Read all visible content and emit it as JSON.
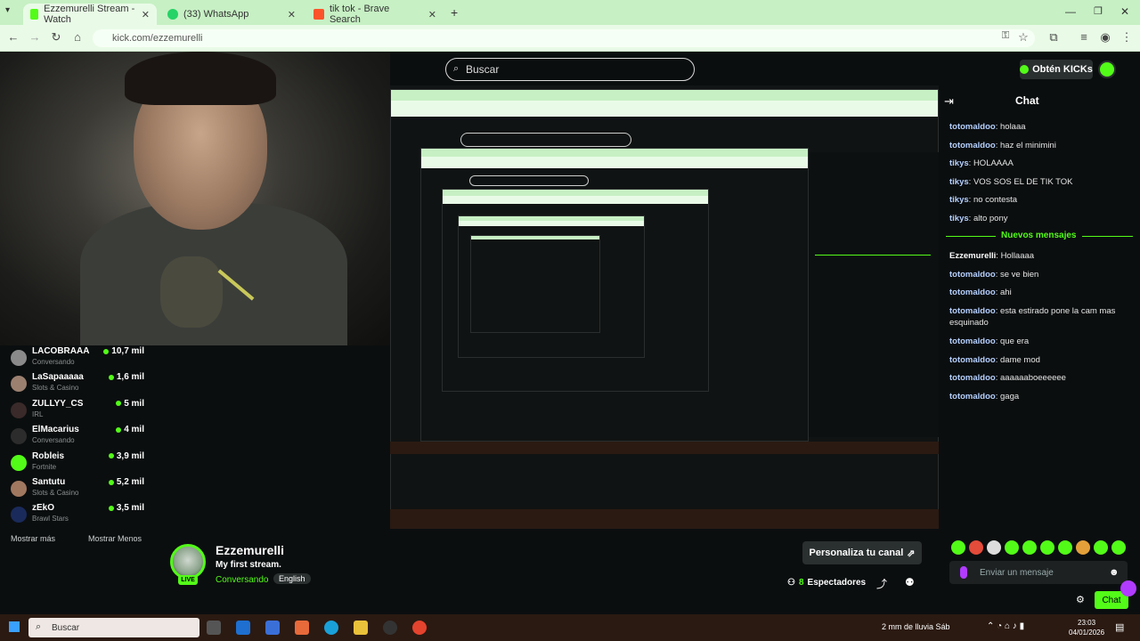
{
  "browser": {
    "tabs": [
      {
        "label": "Ezzemurelli Stream - Watch",
        "active": true,
        "color": "#53fc18"
      },
      {
        "label": "(33) WhatsApp",
        "active": false,
        "color": "#25d366"
      },
      {
        "label": "tik tok - Brave Search",
        "active": false,
        "color": "#fb542b"
      }
    ],
    "url": "kick.com/ezzemurelli"
  },
  "header": {
    "search_placeholder": "Buscar",
    "kicks_button": "Obtén KICKs"
  },
  "chat": {
    "title": "Chat",
    "messages_before": [
      {
        "user": "totomaldoo",
        "text": "holaaa"
      },
      {
        "user": "totomaldoo",
        "text": "haz el minimini"
      },
      {
        "user": "tikys",
        "text": "HOLAAAA"
      },
      {
        "user": "tikys",
        "text": "VOS SOS EL DE TIK TOK"
      },
      {
        "user": "tikys",
        "text": "no contesta"
      },
      {
        "user": "tikys",
        "text": "alto pony"
      }
    ],
    "new_messages_label": "Nuevos mensajes",
    "messages_after": [
      {
        "user": "Ezzemurelli",
        "text": "Hollaaaa"
      },
      {
        "user": "totomaldoo",
        "text": "se ve bien"
      },
      {
        "user": "totomaldoo",
        "text": "ahi"
      },
      {
        "user": "totomaldoo",
        "text": "esta estirado pone la cam mas esquinado"
      },
      {
        "user": "totomaldoo",
        "text": "que era"
      },
      {
        "user": "totomaldoo",
        "text": "dame mod"
      },
      {
        "user": "totomaldoo",
        "text": "aaaaaaboeeeeee"
      },
      {
        "user": "totomaldoo",
        "text": "gaga"
      }
    ],
    "input_placeholder": "Enviar un mensaje",
    "send_label": "Chat"
  },
  "recommended": {
    "channels": [
      {
        "name": "LACOBRAAA",
        "category": "Conversando",
        "viewers": "10,7 mil"
      },
      {
        "name": "LaSapaaaaa",
        "category": "Slots & Casino",
        "viewers": "1,6 mil"
      },
      {
        "name": "ZULLYY_CS",
        "category": "IRL",
        "viewers": "5 mil"
      },
      {
        "name": "ElMacarius",
        "category": "Conversando",
        "viewers": "4 mil"
      },
      {
        "name": "Robleis",
        "category": "Fortnite",
        "viewers": "3,9 mil"
      },
      {
        "name": "Santutu",
        "category": "Slots & Casino",
        "viewers": "5,2 mil"
      },
      {
        "name": "zEkO",
        "category": "Brawl Stars",
        "viewers": "3,5 mil"
      }
    ],
    "show_more": "Mostrar más",
    "show_less": "Mostrar Menos"
  },
  "stream": {
    "streamer": "Ezzemurelli",
    "title": "My first stream.",
    "category": "Conversando",
    "language": "English",
    "live_badge": "LIVE",
    "customize_button": "Personaliza tu canal",
    "viewers_count": "8",
    "viewers_label": "Espectadores"
  },
  "taskbar": {
    "search_placeholder": "Buscar",
    "weather": "2 mm de lluvia Sáb",
    "time": "23:03",
    "date": "04/01/2026"
  }
}
